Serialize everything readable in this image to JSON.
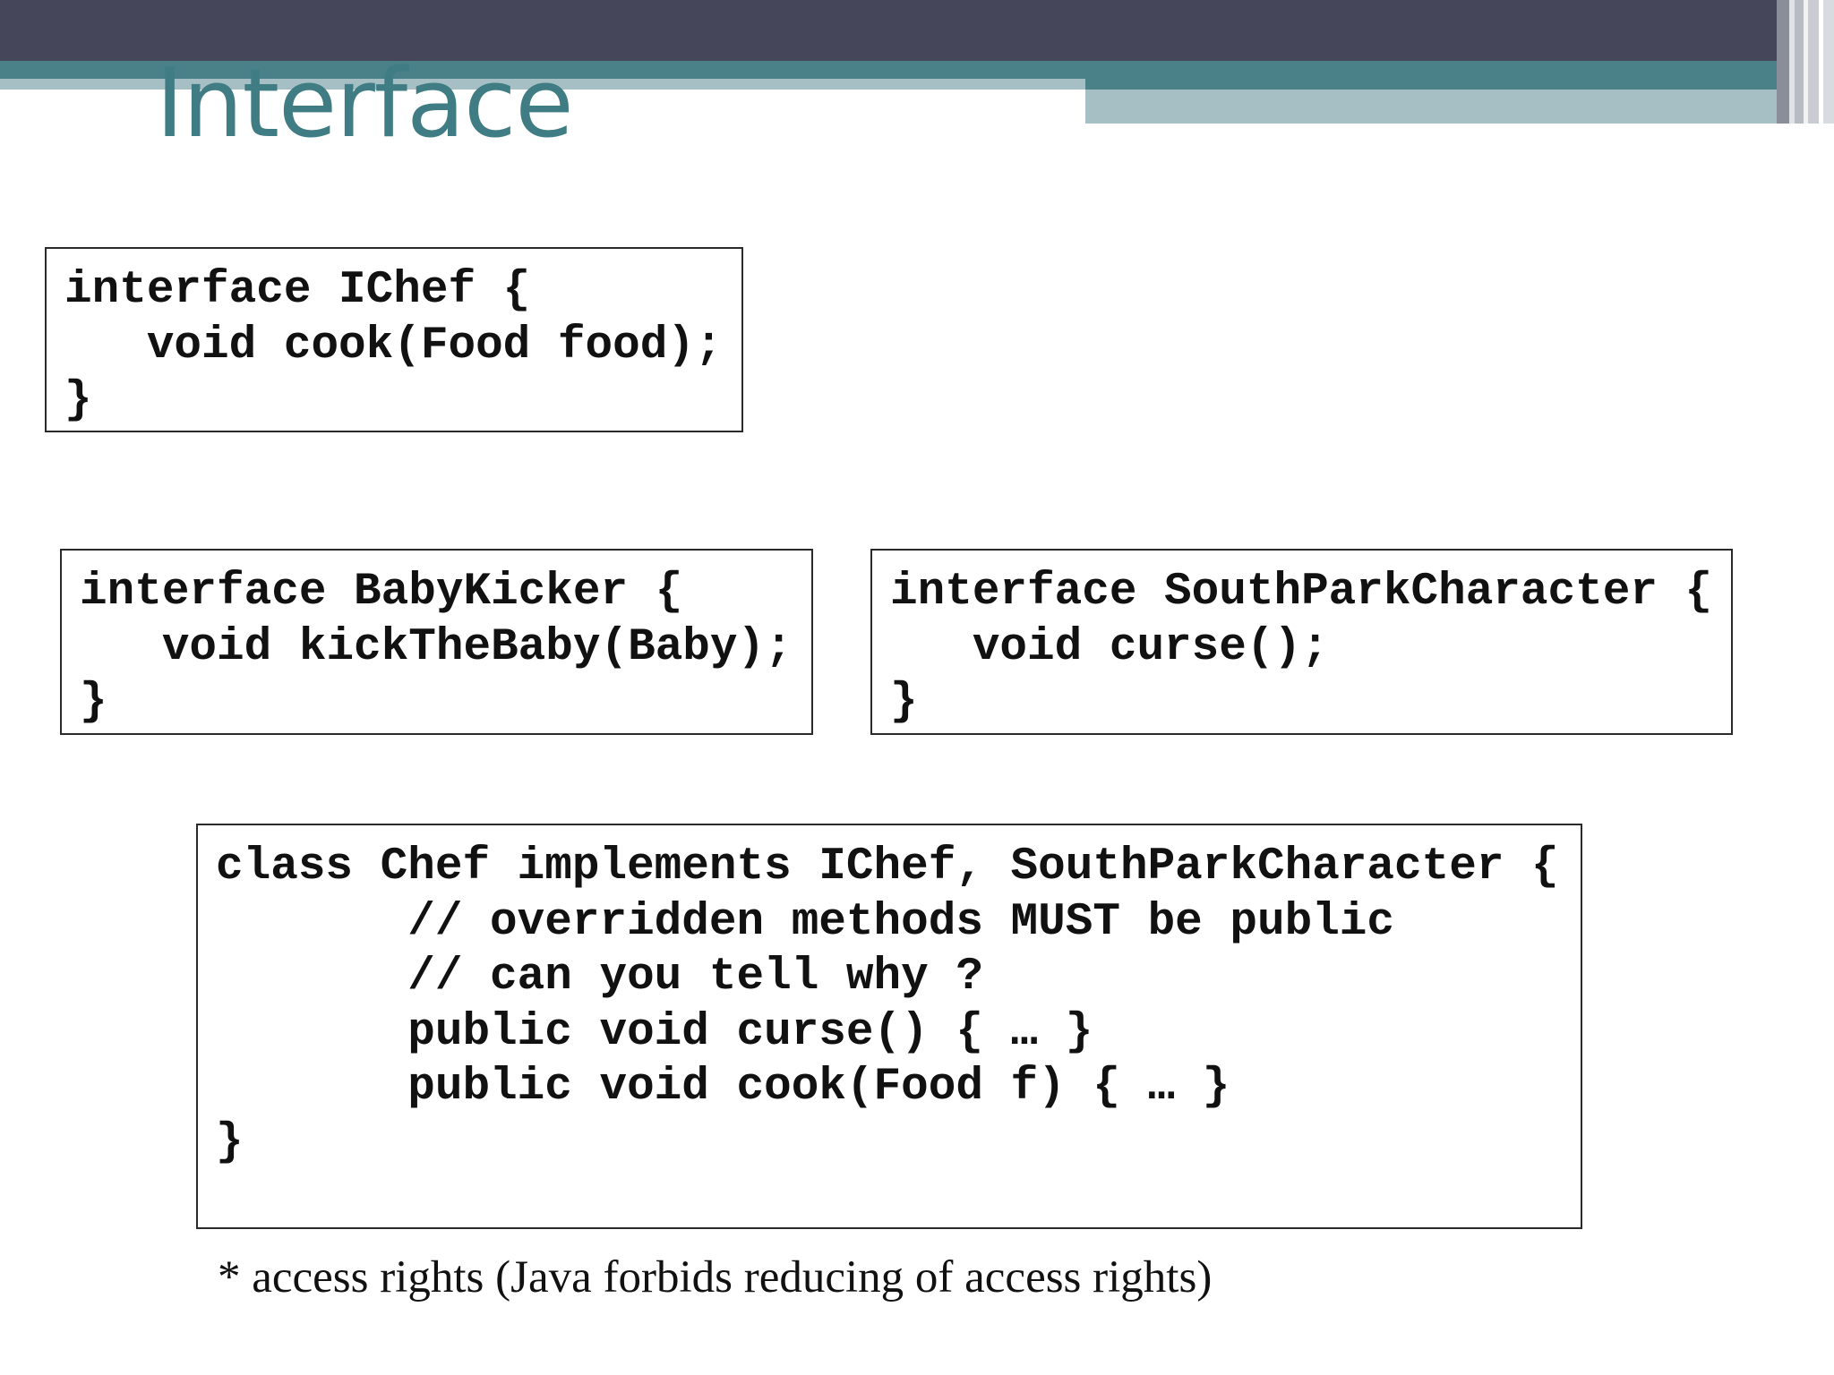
{
  "slide": {
    "title": "Interface"
  },
  "code_blocks": {
    "ichef": {
      "lines": [
        "interface IChef {",
        "   void cook(Food food);",
        "}"
      ]
    },
    "babykicker": {
      "lines": [
        "interface BabyKicker {",
        "   void kickTheBaby(Baby);",
        "}"
      ]
    },
    "southpark": {
      "lines": [
        "interface SouthParkCharacter {",
        "   void curse();",
        "}"
      ]
    },
    "chef": {
      "lines": [
        "class Chef implements IChef, SouthParkCharacter {",
        "       // overridden methods MUST be public",
        "       // can you tell why ?",
        "       public void curse() { … }",
        "       public void cook(Food f) { … }",
        "}"
      ]
    }
  },
  "footnote": "* access rights (Java forbids reducing of access rights)",
  "colors": {
    "header_dark": "#46465a",
    "header_teal": "#4a8088",
    "header_light": "#a6bfc4",
    "title": "#3f7c83"
  }
}
